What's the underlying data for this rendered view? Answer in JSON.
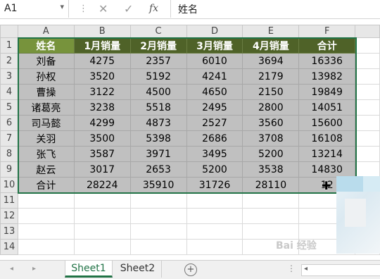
{
  "formula_bar": {
    "cell_ref": "A1",
    "dropdown_icon": "▾",
    "separator_icon": "⋮",
    "cancel_icon": "✕",
    "enter_icon": "✓",
    "fx_label": "fx",
    "content": "姓名"
  },
  "columns": [
    "A",
    "B",
    "C",
    "D",
    "E",
    "F"
  ],
  "rows": [
    "1",
    "2",
    "3",
    "4",
    "5",
    "6",
    "7",
    "8",
    "9",
    "10",
    "11",
    "12",
    "13",
    "14"
  ],
  "header": [
    "姓名",
    "1月销量",
    "2月销量",
    "3月销量",
    "4月销量",
    "合计"
  ],
  "data": [
    [
      "刘备",
      "4275",
      "2357",
      "6010",
      "3694",
      "16336"
    ],
    [
      "孙权",
      "3520",
      "5192",
      "4241",
      "2179",
      "13982"
    ],
    [
      "曹操",
      "3122",
      "4500",
      "4650",
      "2150",
      "19849"
    ],
    [
      "诸葛亮",
      "3238",
      "5518",
      "2495",
      "2800",
      "14051"
    ],
    [
      "司马懿",
      "4299",
      "4873",
      "2527",
      "3560",
      "15600"
    ],
    [
      "关羽",
      "3500",
      "5398",
      "2686",
      "3708",
      "16108"
    ],
    [
      "张飞",
      "3587",
      "3971",
      "3495",
      "5200",
      "13214"
    ],
    [
      "赵云",
      "3017",
      "2653",
      "5200",
      "3538",
      "14830"
    ],
    [
      "合计",
      "28224",
      "35910",
      "31726",
      "28110",
      "12"
    ]
  ],
  "tabs": {
    "nav_prev": "◂",
    "nav_next": "▸",
    "sheet1": "Sheet1",
    "sheet2": "Sheet2",
    "add": "+",
    "dots": "⋮",
    "scroll_left": "◂"
  },
  "watermark": "Bai 经验",
  "colors": {
    "header_green": "#4f6228",
    "selected_header": "#77933c",
    "data_gray": "#c0c0c0",
    "excel_green": "#217346"
  }
}
